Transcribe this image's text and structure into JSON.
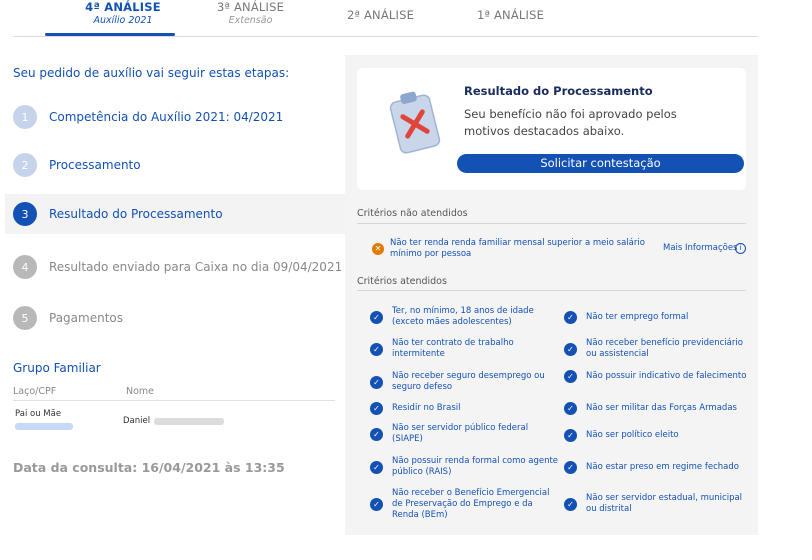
{
  "tabs": [
    {
      "title": "4ª ANÁLISE",
      "subtitle": "Auxílio 2021"
    },
    {
      "title": "3ª ANÁLISE",
      "subtitle": "Extensão"
    },
    {
      "title": "2ª ANÁLISE",
      "subtitle": ""
    },
    {
      "title": "1ª ANÁLISE",
      "subtitle": ""
    }
  ],
  "steps_heading": "Seu pedido de auxílio vai seguir estas etapas:",
  "steps": [
    {
      "num": "1",
      "label": "Competência do Auxílio 2021: 04/2021"
    },
    {
      "num": "2",
      "label": "Processamento"
    },
    {
      "num": "3",
      "label": "Resultado do Processamento"
    },
    {
      "num": "4",
      "label": "Resultado enviado para Caixa no dia 09/04/2021"
    },
    {
      "num": "5",
      "label": "Pagamentos"
    }
  ],
  "grupo": {
    "heading": "Grupo Familiar",
    "col_laco": "Laço/CPF",
    "col_nome": "Nome",
    "rows": [
      {
        "relacao": "Pai ou Mãe",
        "nome": "Daniel"
      }
    ]
  },
  "data_consulta": "Data da consulta: 16/04/2021 às 13:35",
  "resultado": {
    "title": "Resultado do Processamento",
    "text": "Seu benefício não foi aprovado pelos motivos destacados abaixo.",
    "button": "Solicitar contestação"
  },
  "nao_atendidos": {
    "heading": "Critérios não atendidos",
    "items": [
      "Não ter renda renda familiar mensal superior a meio salário mínimo por pessoa"
    ],
    "link": "Mais Informações"
  },
  "atendidos": {
    "heading": "Critérios atendidos",
    "left": [
      "Ter, no mínimo, 18 anos de idade (exceto mães adolescentes)",
      "Não ter contrato de trabalho intermitente",
      "Não receber seguro desemprego ou seguro defeso",
      "Residir no Brasil",
      "Não ser servidor público federal (SIAPE)",
      "Não possuir renda formal como agente público (RAIS)",
      "Não receber o Benefício Emergencial de Preservação do Emprego e da Renda (BEm)"
    ],
    "right": [
      "Não ter emprego formal",
      "Não receber benefício previdenciário ou assistencial",
      "Não possuir indicativo de falecimento",
      "Não ser militar das Forças Armadas",
      "Não ser político eleito",
      "Não estar preso em regime fechado",
      "Não ser servidor estadual, municipal ou distrital"
    ]
  }
}
